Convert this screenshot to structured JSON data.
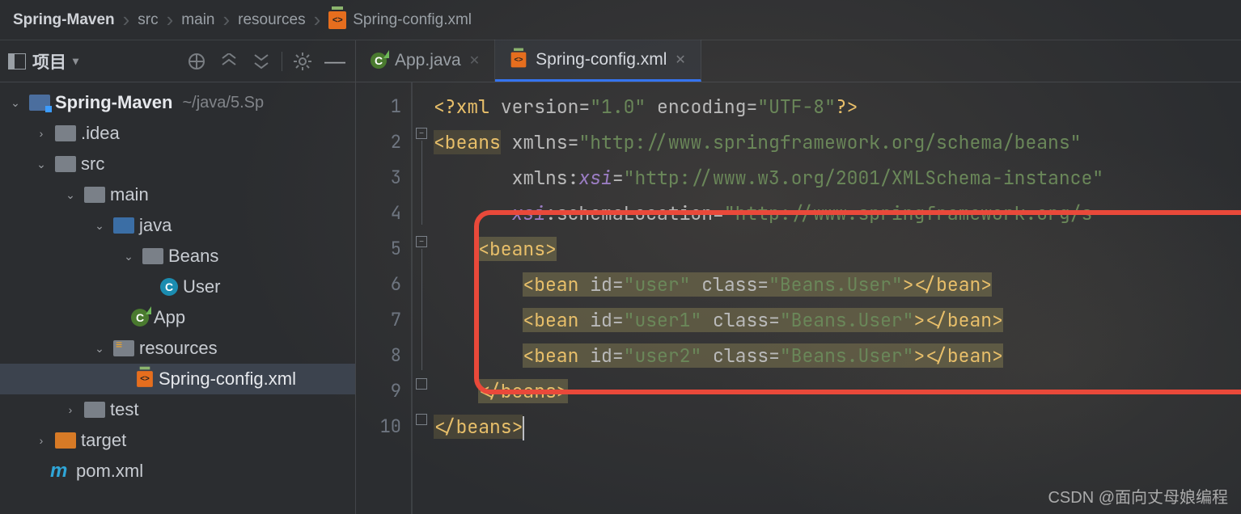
{
  "breadcrumbs": {
    "items": [
      "Spring-Maven",
      "src",
      "main",
      "resources",
      "Spring-config.xml"
    ]
  },
  "sidebar": {
    "title": "项目",
    "tree": {
      "project": "Spring-Maven",
      "project_path": "~/java/5.Sp",
      "idea": ".idea",
      "src": "src",
      "main": "main",
      "java": "java",
      "beans": "Beans",
      "user": "User",
      "app": "App",
      "resources": "resources",
      "config_xml": "Spring-config.xml",
      "test": "test",
      "target": "target",
      "pom": "pom.xml"
    }
  },
  "tabs": {
    "items": [
      {
        "label": "App.java",
        "active": false
      },
      {
        "label": "Spring-config.xml",
        "active": true
      }
    ]
  },
  "code": {
    "lines": [
      "1",
      "2",
      "3",
      "4",
      "5",
      "6",
      "7",
      "8",
      "9",
      "10"
    ],
    "l1": {
      "pi_open": "<?",
      "xml": "xml ",
      "attr_v": "version",
      "eq": "=",
      "v": "\"1.0\"",
      "attr_e": " encoding",
      "e": "\"UTF-8\"",
      "pi_close": "?>"
    },
    "l2": {
      "tag_open": "<beans",
      "attr": " xmlns",
      "eq": "=",
      "val": "\"http://www.springframework.org/schema/beans\""
    },
    "l3": {
      "ns_pref": "xmlns:",
      "ns": "xsi",
      "eq": "=",
      "val": "\"http://www.w3.org/2001/XMLSchema-instance\""
    },
    "l4": {
      "ns": "xsi",
      "attr": ":schemaLocation",
      "eq": "=",
      "val": "\"http://www.springframework.org/s"
    },
    "l5": {
      "tag": "<beans>"
    },
    "l6": {
      "tag_o": "<bean",
      "a_id": " id",
      "eq1": "=",
      "v_id": "\"user\"",
      "a_cls": " class",
      "eq2": "=",
      "v_cls": "\"Beans.User\"",
      "close": "></bean>"
    },
    "l7": {
      "tag_o": "<bean",
      "a_id": " id",
      "eq1": "=",
      "v_id": "\"user1\"",
      "a_cls": " class",
      "eq2": "=",
      "v_cls": "\"Beans.User\"",
      "close": "></bean>"
    },
    "l8": {
      "tag_o": "<bean",
      "a_id": " id",
      "eq1": "=",
      "v_id": "\"user2\"",
      "a_cls": " class",
      "eq2": "=",
      "v_cls": "\"Beans.User\"",
      "close": "></bean>"
    },
    "l9": {
      "tag": "</beans>"
    },
    "l10": {
      "tag": "</beans>"
    }
  },
  "watermark": "CSDN @面向丈母娘编程"
}
